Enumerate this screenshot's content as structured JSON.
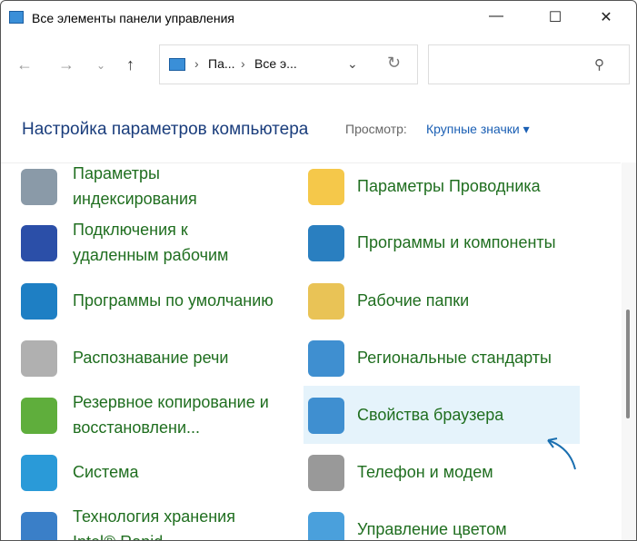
{
  "window": {
    "title": "Все элементы панели управления",
    "minimize": "—",
    "maximize": "☐",
    "close": "✕"
  },
  "nav": {
    "back": "←",
    "forward": "→",
    "recent": "⌄",
    "up": "↑"
  },
  "address": {
    "crumbs": [
      "Па...",
      "Все э..."
    ],
    "sep": "›",
    "dropdown": "⌄",
    "refresh": "↻"
  },
  "search": {
    "icon": "⚲"
  },
  "header": {
    "title": "Настройка параметров компьютера",
    "view_label": "Просмотр:",
    "view_value": "Крупные значки ▾"
  },
  "items_left": [
    {
      "label": "Параметры индексирования",
      "icon": "indexing-icon",
      "color": "#8a9aa8"
    },
    {
      "label": "Подключения к удаленным рабочим",
      "icon": "remote-desktop-icon",
      "color": "#2b4fa8"
    },
    {
      "label": "Программы по умолчанию",
      "icon": "default-programs-icon",
      "color": "#1e7fc4"
    },
    {
      "label": "Распознавание речи",
      "icon": "microphone-icon",
      "color": "#b0b0b0"
    },
    {
      "label": "Резервное копирование и восстановлени...",
      "icon": "backup-icon",
      "color": "#5fae3c"
    },
    {
      "label": "Система",
      "icon": "system-icon",
      "color": "#2a9ad8"
    },
    {
      "label": "Технология хранения Intel® Rapid",
      "icon": "intel-storage-icon",
      "color": "#3a7fc8"
    }
  ],
  "items_right": [
    {
      "label": "Параметры Проводника",
      "icon": "folder-options-icon",
      "color": "#f5c84a"
    },
    {
      "label": "Программы и компоненты",
      "icon": "programs-features-icon",
      "color": "#2a7fc0"
    },
    {
      "label": "Рабочие папки",
      "icon": "work-folders-icon",
      "color": "#e9c356"
    },
    {
      "label": "Региональные стандарты",
      "icon": "region-icon",
      "color": "#3f8fd0"
    },
    {
      "label": "Свойства браузера",
      "icon": "internet-options-icon",
      "color": "#3f8fd0"
    },
    {
      "label": "Телефон и модем",
      "icon": "phone-modem-icon",
      "color": "#999999"
    },
    {
      "label": "Управление цветом",
      "icon": "color-management-icon",
      "color": "#4aa0dc"
    }
  ]
}
